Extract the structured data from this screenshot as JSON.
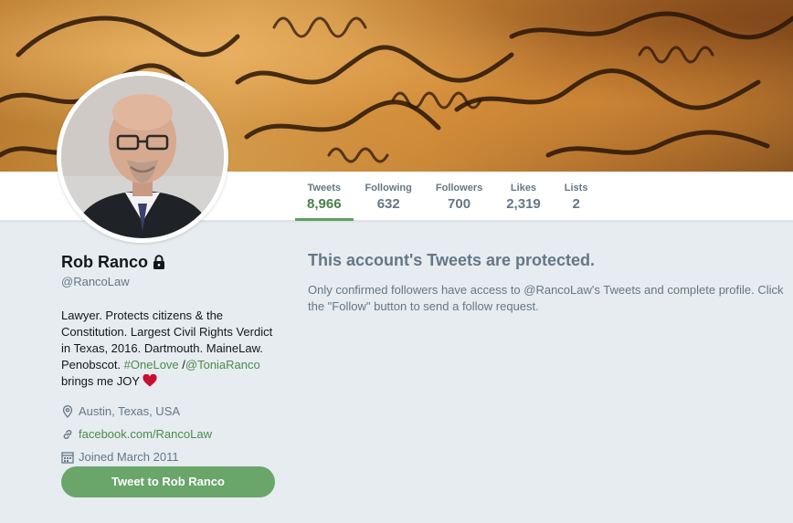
{
  "banner": {
    "description_icon": "parchment-script-banner"
  },
  "navbar": {
    "stats": [
      {
        "label": "Tweets",
        "value": "8,966",
        "active": true
      },
      {
        "label": "Following",
        "value": "632",
        "active": false
      },
      {
        "label": "Followers",
        "value": "700",
        "active": false
      },
      {
        "label": "Likes",
        "value": "2,319",
        "active": false
      },
      {
        "label": "Lists",
        "value": "2",
        "active": false
      }
    ]
  },
  "profile": {
    "name": "Rob Ranco",
    "handle": "@RancoLaw",
    "bio": {
      "text1": "Lawyer. Protects citizens & the Constitution. Largest Civil Rights Verdict in Texas, 2016. Dartmouth. MaineLaw. Penobscot. ",
      "hashtag": "#OneLove",
      "separator": " /",
      "mention": "@ToniaRanco",
      "text2": " brings me JOY "
    },
    "location": "Austin, Texas, USA",
    "website": "facebook.com/RancoLaw",
    "joined": "Joined March 2011",
    "tweet_button": "Tweet to Rob Ranco"
  },
  "protected": {
    "title": "This account's Tweets are protected.",
    "message": "Only confirmed followers have access to @RancoLaw's Tweets and complete profile. Click the \"Follow\" button to send a follow request."
  },
  "colors": {
    "accent": "#6aa56a",
    "accent_text": "#4a8c4a",
    "heart": "#c8102e"
  }
}
